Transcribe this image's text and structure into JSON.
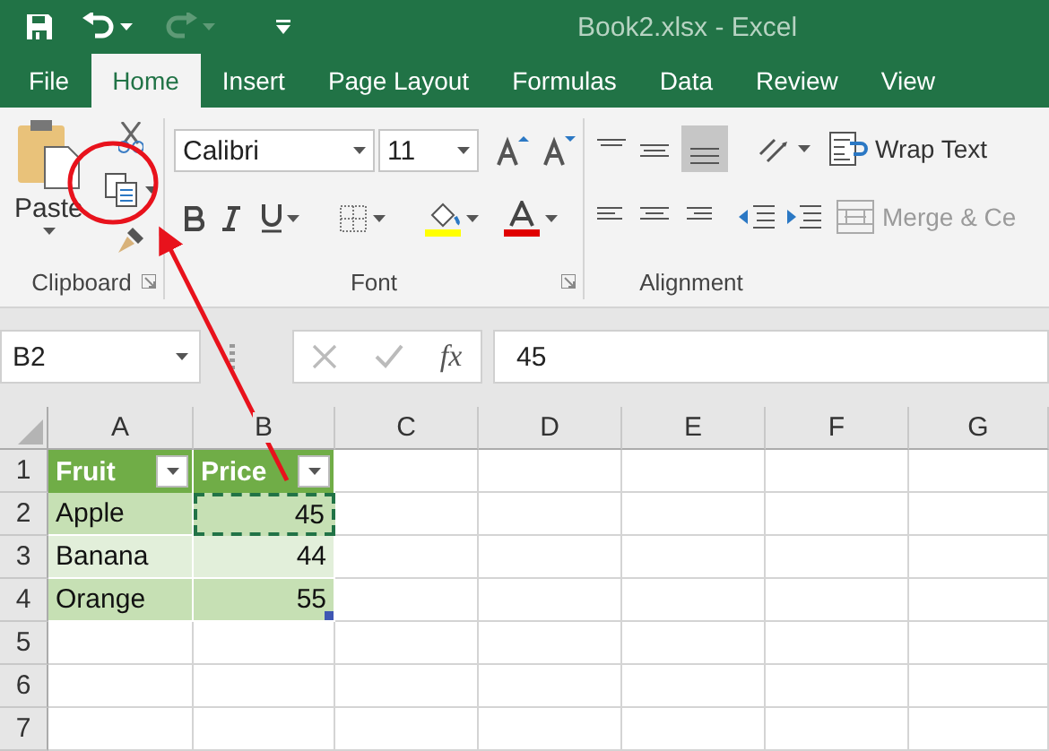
{
  "window": {
    "title": "Book2.xlsx - Excel"
  },
  "quick_access": [
    {
      "kind": "save",
      "disabled": false
    },
    {
      "kind": "undo",
      "disabled": false
    },
    {
      "kind": "redo",
      "disabled": true
    },
    {
      "kind": "customize",
      "disabled": false
    }
  ],
  "tabs": [
    {
      "label": "File",
      "selected": false
    },
    {
      "label": "Home",
      "selected": true
    },
    {
      "label": "Insert",
      "selected": false
    },
    {
      "label": "Page Layout",
      "selected": false
    },
    {
      "label": "Formulas",
      "selected": false
    },
    {
      "label": "Data",
      "selected": false
    },
    {
      "label": "Review",
      "selected": false
    },
    {
      "label": "View",
      "selected": false
    }
  ],
  "ribbon": {
    "clipboard": {
      "label": "Clipboard",
      "paste": "Paste"
    },
    "font": {
      "label": "Font",
      "font_name": "Calibri",
      "font_size": "11"
    },
    "alignment": {
      "label": "Alignment",
      "buttons": [
        {
          "label": "Wrap Text",
          "kind": "wrap",
          "disabled": false
        },
        {
          "label": "Merge & Ce",
          "kind": "merge",
          "disabled": true
        }
      ]
    }
  },
  "formula_bar": {
    "name_box": "B2",
    "function_label": "fx",
    "value": "45"
  },
  "sheet": {
    "column_headers": [
      "A",
      "B",
      "C",
      "D",
      "E",
      "F",
      "G"
    ],
    "row_numbers": [
      "1",
      "2",
      "3",
      "4",
      "5",
      "6",
      "7"
    ]
  },
  "table": {
    "columns": [
      {
        "label": "Fruit",
        "kind": "text"
      },
      {
        "label": "Price",
        "kind": "number"
      }
    ],
    "rows": [
      {
        "cells": [
          {
            "text": "Apple",
            "copied": false
          },
          {
            "text": "45",
            "copied": true
          }
        ]
      },
      {
        "cells": [
          {
            "text": "Banana",
            "copied": false
          },
          {
            "text": "44",
            "copied": false
          }
        ]
      },
      {
        "cells": [
          {
            "text": "Orange",
            "copied": false
          },
          {
            "text": "55",
            "copied": false
          }
        ]
      }
    ]
  }
}
